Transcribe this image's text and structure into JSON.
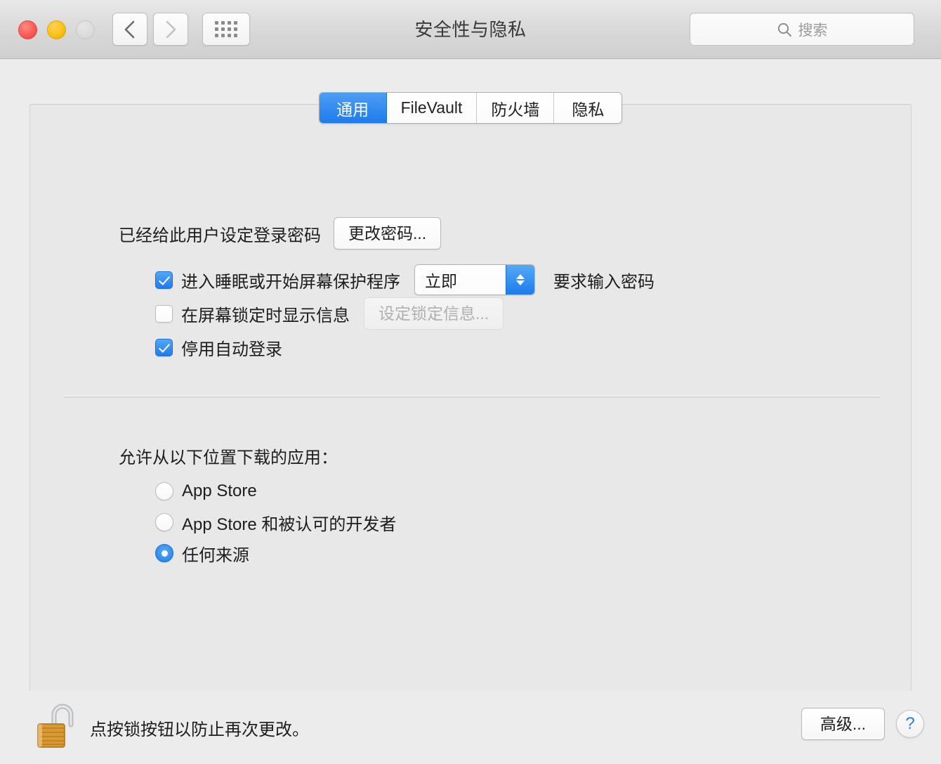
{
  "window": {
    "title": "安全性与隐私",
    "traffic_lights": {
      "close": "close-button",
      "minimize": "minimize-button",
      "zoom": "zoom-button"
    },
    "nav": {
      "back": "back-icon",
      "forward": "forward-icon",
      "show_all": "grid-icon"
    },
    "search": {
      "placeholder": "搜索",
      "icon": "search-icon"
    }
  },
  "tabs": [
    {
      "label": "通用",
      "active": true
    },
    {
      "label": "FileVault",
      "active": false
    },
    {
      "label": "防火墙",
      "active": false
    },
    {
      "label": "隐私",
      "active": false
    }
  ],
  "general": {
    "password_status": "已经给此用户设定登录密码",
    "change_password_button": "更改密码...",
    "options": [
      {
        "label": "进入睡眠或开始屏幕保护程序",
        "checked": true,
        "popup_value": "立即",
        "suffix": "要求输入密码"
      },
      {
        "label": "在屏幕锁定时显示信息",
        "checked": false,
        "button": "设定锁定信息...",
        "button_disabled": true
      },
      {
        "label": "停用自动登录",
        "checked": true
      }
    ],
    "download_section_title": "允许从以下位置下载的应用：",
    "download_options": [
      {
        "label": "App Store",
        "selected": false
      },
      {
        "label": "App Store 和被认可的开发者",
        "selected": false
      },
      {
        "label": "任何来源",
        "selected": true
      }
    ]
  },
  "bottom": {
    "lock_icon": "unlocked-padlock-icon",
    "lock_note": "点按锁按钮以防止再次更改。",
    "advanced_button": "高级...",
    "help_button": "?"
  },
  "colors": {
    "accent_blue": "#1d7ceb",
    "window_bg": "#ececec",
    "panel_bg": "#e8e8e8",
    "lock_gold": "#d8922c"
  }
}
